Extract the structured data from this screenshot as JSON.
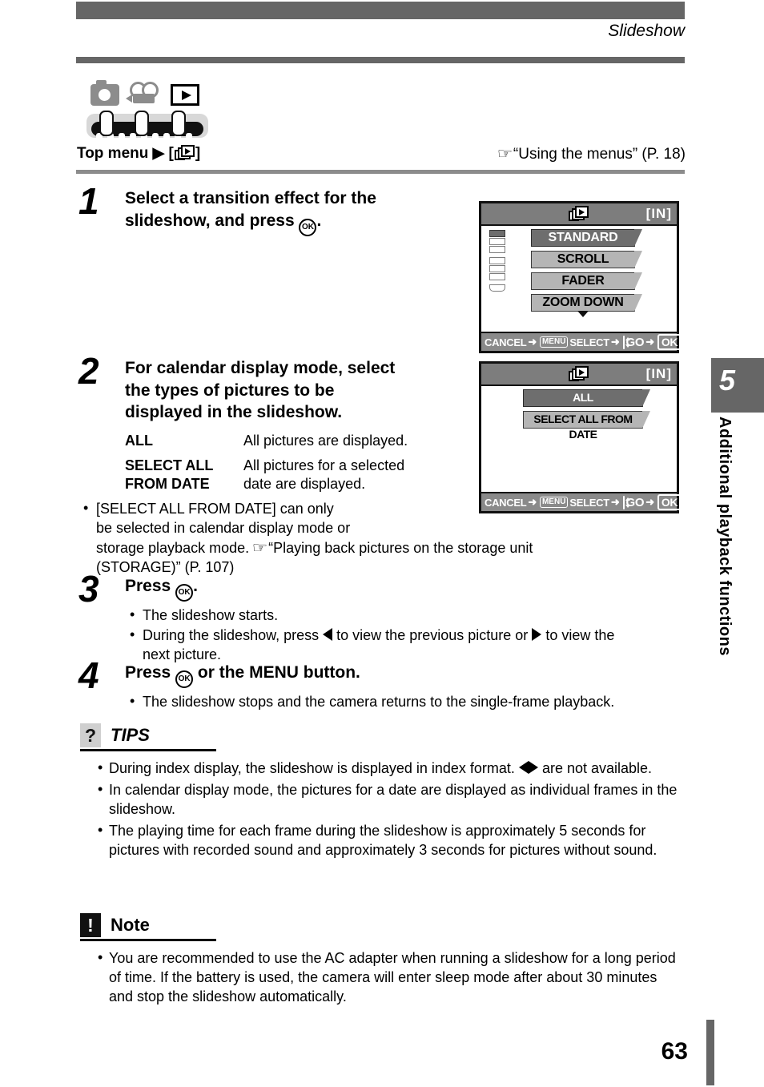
{
  "header": {
    "running_head": "Slideshow",
    "top_menu_label": "Top menu",
    "top_menu_arrow": "▶",
    "top_menu_bracket_open": "[",
    "top_menu_bracket_close": "]",
    "reference": "“Using the menus” (P. 18)"
  },
  "mode_icons": {
    "camera": "camera-mode-icon",
    "movie": "movie-mode-icon",
    "playback": "playback-mode-icon",
    "dial": "mode-dial"
  },
  "steps": [
    {
      "number": "1",
      "title_line1": "Select a transition effect for the",
      "title_line2_pre": "slideshow, and press",
      "title_line2_post": ".",
      "ok_glyph": "OK"
    },
    {
      "number": "2",
      "title_line1": "For calendar display mode, select",
      "title_line2": "the types of pictures to be",
      "title_line3": "displayed in the slideshow.",
      "definitions": [
        {
          "term": "ALL",
          "desc": "All pictures are displayed."
        },
        {
          "term": "SELECT ALL FROM DATE",
          "term_line1": "SELECT ALL",
          "term_line2": "FROM DATE",
          "desc_line1": "All pictures for a selected",
          "desc_line2": "date are displayed."
        }
      ],
      "note_line1": "[SELECT ALL FROM DATE] can only",
      "note_line2": "be selected in calendar display mode or",
      "note_line3_pre": "storage playback mode.",
      "note_line3_ref": "“Playing back pictures on the storage unit",
      "note_line4": "(STORAGE)” (P. 107)"
    },
    {
      "number": "3",
      "title_pre": "Press",
      "title_post": ".",
      "ok_glyph": "OK",
      "bullets": [
        "The slideshow starts.",
        "During the slideshow, press ◁ to view the previous picture or ▷ to view the next picture."
      ],
      "bullet2_part1": "During the slideshow, press",
      "bullet2_part2": "to view the previous picture or",
      "bullet2_part3": "to view the",
      "bullet2_part4": "next picture."
    },
    {
      "number": "4",
      "title_pre": "Press",
      "title_post": "or the MENU button.",
      "ok_glyph": "OK",
      "bullets": [
        "The slideshow stops and the camera returns to the single-frame playback."
      ]
    }
  ],
  "lcd_screens": [
    {
      "name": "transition-effect-menu",
      "status_in": "[IN]",
      "items": [
        {
          "label": "STANDARD",
          "selected": true
        },
        {
          "label": "SCROLL",
          "selected": false
        },
        {
          "label": "FADER",
          "selected": false
        },
        {
          "label": "ZOOM DOWN",
          "selected": false
        }
      ],
      "has_more_caret": true,
      "has_page_stack": true,
      "guide": {
        "cancel": "CANCEL",
        "menu_badge": "MENU",
        "select": "SELECT",
        "go": "GO",
        "ok_badge": "OK",
        "arrow": "➜"
      }
    },
    {
      "name": "picture-type-menu",
      "status_in": "[IN]",
      "items": [
        {
          "label": "ALL",
          "selected": true
        },
        {
          "label": "SELECT ALL FROM DATE",
          "selected": false
        }
      ],
      "has_more_caret": false,
      "has_page_stack": false,
      "guide": {
        "cancel": "CANCEL",
        "menu_badge": "MENU",
        "select": "SELECT",
        "go": "GO",
        "ok_badge": "OK",
        "arrow": "➜"
      }
    }
  ],
  "tips": {
    "icon": "?",
    "title": "TIPS",
    "bullets_text": [
      "During index display, the slideshow is displayed in index format. ◁▷ are not available.",
      "In calendar display mode, the pictures for a date are displayed as individual frames in the slideshow.",
      "The playing time for each frame during the slideshow is approximately 5 seconds for pictures with recorded sound and approximately 3 seconds for pictures without sound."
    ],
    "bullet1_part1": "During index display, the slideshow is displayed in index format.",
    "bullet1_part2": "are not available.",
    "bullet2": "In calendar display mode, the pictures for a date are displayed as individual frames in the slideshow.",
    "bullet3": "The playing time for each frame during the slideshow is approximately 5 seconds for pictures with recorded sound and approximately 3 seconds for pictures without sound."
  },
  "note": {
    "icon": "!",
    "title": "Note",
    "bullet1": "You are recommended to use the AC adapter when running a slideshow for a long period of time. If the battery is used, the camera will enter sleep mode after about 30 minutes and stop the slideshow automatically."
  },
  "chapter": {
    "number": "5",
    "title": "Additional playback functions"
  },
  "footer": {
    "page_number": "63"
  },
  "colors": {
    "rule_gray": "#666666",
    "lcd_header_gray": "#7d7d7d",
    "lcd_item_gray": "#b5b5b5",
    "lcd_item_selected_gray": "#6e6e6e"
  }
}
